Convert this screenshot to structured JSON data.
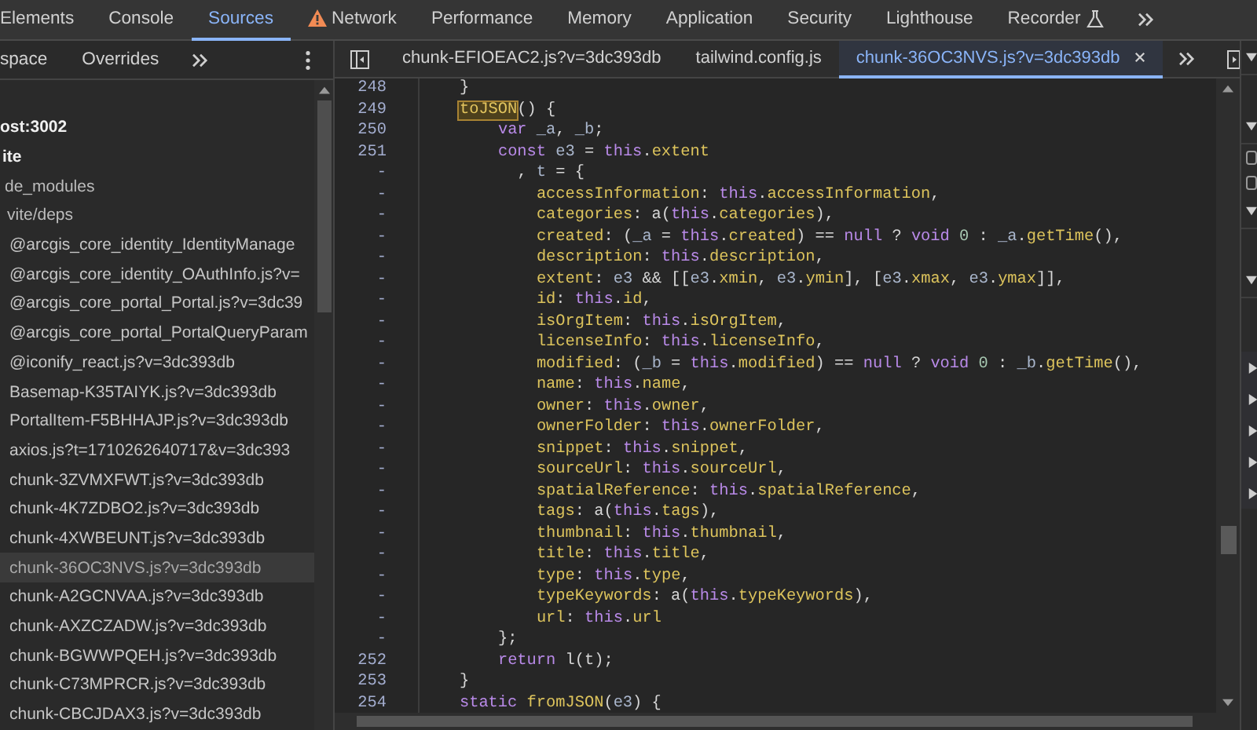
{
  "top_tabs": [
    {
      "label": "Elements",
      "selected": false,
      "kind": "plain"
    },
    {
      "label": "Console",
      "selected": false,
      "kind": "plain"
    },
    {
      "label": "Sources",
      "selected": true,
      "kind": "plain"
    },
    {
      "label": "Network",
      "selected": false,
      "kind": "warning"
    },
    {
      "label": "Performance",
      "selected": false,
      "kind": "plain"
    },
    {
      "label": "Memory",
      "selected": false,
      "kind": "plain"
    },
    {
      "label": "Application",
      "selected": false,
      "kind": "plain"
    },
    {
      "label": "Security",
      "selected": false,
      "kind": "plain"
    },
    {
      "label": "Lighthouse",
      "selected": false,
      "kind": "plain"
    },
    {
      "label": "Recorder",
      "selected": false,
      "kind": "experimental"
    }
  ],
  "navigator_tabs": [
    {
      "label": "space",
      "selected": false
    },
    {
      "label": "Overrides",
      "selected": false
    }
  ],
  "tree": [
    {
      "label": "ost:3002",
      "kind": "origin",
      "selected": false,
      "children": [
        {
          "label": "ite",
          "kind": "origin",
          "selected": false,
          "children": [
            {
              "label": "de_modules",
              "kind": "folder",
              "selected": false,
              "children": [
                {
                  "label": "vite/deps",
                  "kind": "folder",
                  "selected": false,
                  "children": [
                    {
                      "label": "@arcgis_core_identity_IdentityManage",
                      "kind": "file",
                      "selected": false
                    },
                    {
                      "label": "@arcgis_core_identity_OAuthInfo.js?v=",
                      "kind": "file",
                      "selected": false
                    },
                    {
                      "label": "@arcgis_core_portal_Portal.js?v=3dc39",
                      "kind": "file",
                      "selected": false
                    },
                    {
                      "label": "@arcgis_core_portal_PortalQueryParam",
                      "kind": "file",
                      "selected": false
                    },
                    {
                      "label": "@iconify_react.js?v=3dc393db",
                      "kind": "file",
                      "selected": false
                    },
                    {
                      "label": "Basemap-K35TAIYK.js?v=3dc393db",
                      "kind": "file",
                      "selected": false
                    },
                    {
                      "label": "PortalItem-F5BHHAJP.js?v=3dc393db",
                      "kind": "file",
                      "selected": false
                    },
                    {
                      "label": "axios.js?t=1710262640717&v=3dc393",
                      "kind": "file",
                      "selected": false
                    },
                    {
                      "label": "chunk-3ZVMXFWT.js?v=3dc393db",
                      "kind": "file",
                      "selected": false
                    },
                    {
                      "label": "chunk-4K7ZDBO2.js?v=3dc393db",
                      "kind": "file",
                      "selected": false
                    },
                    {
                      "label": "chunk-4XWBEUNT.js?v=3dc393db",
                      "kind": "file",
                      "selected": false
                    },
                    {
                      "label": "chunk-36OC3NVS.js?v=3dc393db",
                      "kind": "file",
                      "selected": true
                    },
                    {
                      "label": "chunk-A2GCNVAA.js?v=3dc393db",
                      "kind": "file",
                      "selected": false
                    },
                    {
                      "label": "chunk-AXZCZADW.js?v=3dc393db",
                      "kind": "file",
                      "selected": false
                    },
                    {
                      "label": "chunk-BGWWPQEH.js?v=3dc393db",
                      "kind": "file",
                      "selected": false
                    },
                    {
                      "label": "chunk-C73MPRCR.js?v=3dc393db",
                      "kind": "file",
                      "selected": false
                    },
                    {
                      "label": "chunk-CBCJDAX3.js?v=3dc393db",
                      "kind": "file",
                      "selected": false
                    }
                  ]
                }
              ]
            }
          ]
        }
      ]
    }
  ],
  "file_tabs": [
    {
      "label": "chunk-EFIOEAC2.js?v=3dc393db",
      "selected": false
    },
    {
      "label": "tailwind.config.js",
      "selected": false
    },
    {
      "label": "chunk-36OC3NVS.js?v=3dc393db",
      "selected": true
    }
  ],
  "code_lines": [
    {
      "number": "248",
      "kind": "member",
      "tokens": [
        {
          "kind": "punc",
          "text": "}"
        }
      ]
    },
    {
      "number": "249",
      "kind": "member",
      "tokens": [
        {
          "kind": "match",
          "text": "toJSON"
        },
        {
          "kind": "punc",
          "text": "() {"
        }
      ]
    },
    {
      "number": "250",
      "kind": "statement",
      "tokens": [
        {
          "kind": "kw",
          "text": "var"
        },
        {
          "kind": "var",
          "text": " _a"
        },
        {
          "kind": "punc",
          "text": ", "
        },
        {
          "kind": "var",
          "text": "_b"
        },
        {
          "kind": "punc",
          "text": ";"
        }
      ]
    },
    {
      "number": "251",
      "kind": "statement",
      "tokens": [
        {
          "kind": "kw",
          "text": "const"
        },
        {
          "kind": "var",
          "text": " e3"
        },
        {
          "kind": "punc",
          "text": " = "
        },
        {
          "kind": "kw",
          "text": "this"
        },
        {
          "kind": "punc",
          "text": "."
        },
        {
          "kind": "prop",
          "text": "extent"
        }
      ]
    },
    {
      "number": "-",
      "kind": "continuation",
      "tokens": [
        {
          "kind": "punc",
          "text": ", "
        },
        {
          "kind": "var",
          "text": "t"
        },
        {
          "kind": "punc",
          "text": " = {"
        }
      ]
    },
    {
      "number": "-",
      "kind": "property",
      "tokens": [
        {
          "kind": "prop",
          "text": "accessInformation"
        },
        {
          "kind": "punc",
          "text": ": "
        },
        {
          "kind": "kw",
          "text": "this"
        },
        {
          "kind": "punc",
          "text": "."
        },
        {
          "kind": "prop",
          "text": "accessInformation"
        },
        {
          "kind": "punc",
          "text": ","
        }
      ]
    },
    {
      "number": "-",
      "kind": "property",
      "tokens": [
        {
          "kind": "prop",
          "text": "categories"
        },
        {
          "kind": "punc",
          "text": ": a("
        },
        {
          "kind": "kw",
          "text": "this"
        },
        {
          "kind": "punc",
          "text": "."
        },
        {
          "kind": "prop",
          "text": "categories"
        },
        {
          "kind": "punc",
          "text": "),"
        }
      ]
    },
    {
      "number": "-",
      "kind": "property",
      "tokens": [
        {
          "kind": "prop",
          "text": "created"
        },
        {
          "kind": "punc",
          "text": ": ("
        },
        {
          "kind": "var",
          "text": "_a"
        },
        {
          "kind": "punc",
          "text": " = "
        },
        {
          "kind": "kw",
          "text": "this"
        },
        {
          "kind": "punc",
          "text": "."
        },
        {
          "kind": "prop",
          "text": "created"
        },
        {
          "kind": "punc",
          "text": ") == "
        },
        {
          "kind": "kw",
          "text": "null"
        },
        {
          "kind": "punc",
          "text": " ? "
        },
        {
          "kind": "kw",
          "text": "void"
        },
        {
          "kind": "num",
          "text": " 0"
        },
        {
          "kind": "punc",
          "text": " : "
        },
        {
          "kind": "var",
          "text": "_a"
        },
        {
          "kind": "punc",
          "text": "."
        },
        {
          "kind": "prop",
          "text": "getTime"
        },
        {
          "kind": "punc",
          "text": "(),"
        }
      ]
    },
    {
      "number": "-",
      "kind": "property",
      "tokens": [
        {
          "kind": "prop",
          "text": "description"
        },
        {
          "kind": "punc",
          "text": ": "
        },
        {
          "kind": "kw",
          "text": "this"
        },
        {
          "kind": "punc",
          "text": "."
        },
        {
          "kind": "prop",
          "text": "description"
        },
        {
          "kind": "punc",
          "text": ","
        }
      ]
    },
    {
      "number": "-",
      "kind": "property",
      "tokens": [
        {
          "kind": "prop",
          "text": "extent"
        },
        {
          "kind": "punc",
          "text": ": "
        },
        {
          "kind": "var",
          "text": "e3"
        },
        {
          "kind": "punc",
          "text": " && [["
        },
        {
          "kind": "var",
          "text": "e3"
        },
        {
          "kind": "punc",
          "text": "."
        },
        {
          "kind": "prop",
          "text": "xmin"
        },
        {
          "kind": "punc",
          "text": ", "
        },
        {
          "kind": "var",
          "text": "e3"
        },
        {
          "kind": "punc",
          "text": "."
        },
        {
          "kind": "prop",
          "text": "ymin"
        },
        {
          "kind": "punc",
          "text": "], ["
        },
        {
          "kind": "var",
          "text": "e3"
        },
        {
          "kind": "punc",
          "text": "."
        },
        {
          "kind": "prop",
          "text": "xmax"
        },
        {
          "kind": "punc",
          "text": ", "
        },
        {
          "kind": "var",
          "text": "e3"
        },
        {
          "kind": "punc",
          "text": "."
        },
        {
          "kind": "prop",
          "text": "ymax"
        },
        {
          "kind": "punc",
          "text": "]],"
        }
      ]
    },
    {
      "number": "-",
      "kind": "property",
      "tokens": [
        {
          "kind": "prop",
          "text": "id"
        },
        {
          "kind": "punc",
          "text": ": "
        },
        {
          "kind": "kw",
          "text": "this"
        },
        {
          "kind": "punc",
          "text": "."
        },
        {
          "kind": "prop",
          "text": "id"
        },
        {
          "kind": "punc",
          "text": ","
        }
      ]
    },
    {
      "number": "-",
      "kind": "property",
      "tokens": [
        {
          "kind": "prop",
          "text": "isOrgItem"
        },
        {
          "kind": "punc",
          "text": ": "
        },
        {
          "kind": "kw",
          "text": "this"
        },
        {
          "kind": "punc",
          "text": "."
        },
        {
          "kind": "prop",
          "text": "isOrgItem"
        },
        {
          "kind": "punc",
          "text": ","
        }
      ]
    },
    {
      "number": "-",
      "kind": "property",
      "tokens": [
        {
          "kind": "prop",
          "text": "licenseInfo"
        },
        {
          "kind": "punc",
          "text": ": "
        },
        {
          "kind": "kw",
          "text": "this"
        },
        {
          "kind": "punc",
          "text": "."
        },
        {
          "kind": "prop",
          "text": "licenseInfo"
        },
        {
          "kind": "punc",
          "text": ","
        }
      ]
    },
    {
      "number": "-",
      "kind": "property",
      "tokens": [
        {
          "kind": "prop",
          "text": "modified"
        },
        {
          "kind": "punc",
          "text": ": ("
        },
        {
          "kind": "var",
          "text": "_b"
        },
        {
          "kind": "punc",
          "text": " = "
        },
        {
          "kind": "kw",
          "text": "this"
        },
        {
          "kind": "punc",
          "text": "."
        },
        {
          "kind": "prop",
          "text": "modified"
        },
        {
          "kind": "punc",
          "text": ") == "
        },
        {
          "kind": "kw",
          "text": "null"
        },
        {
          "kind": "punc",
          "text": " ? "
        },
        {
          "kind": "kw",
          "text": "void"
        },
        {
          "kind": "num",
          "text": " 0"
        },
        {
          "kind": "punc",
          "text": " : "
        },
        {
          "kind": "var",
          "text": "_b"
        },
        {
          "kind": "punc",
          "text": "."
        },
        {
          "kind": "prop",
          "text": "getTime"
        },
        {
          "kind": "punc",
          "text": "(),"
        }
      ]
    },
    {
      "number": "-",
      "kind": "property",
      "tokens": [
        {
          "kind": "prop",
          "text": "name"
        },
        {
          "kind": "punc",
          "text": ": "
        },
        {
          "kind": "kw",
          "text": "this"
        },
        {
          "kind": "punc",
          "text": "."
        },
        {
          "kind": "prop",
          "text": "name"
        },
        {
          "kind": "punc",
          "text": ","
        }
      ]
    },
    {
      "number": "-",
      "kind": "property",
      "tokens": [
        {
          "kind": "prop",
          "text": "owner"
        },
        {
          "kind": "punc",
          "text": ": "
        },
        {
          "kind": "kw",
          "text": "this"
        },
        {
          "kind": "punc",
          "text": "."
        },
        {
          "kind": "prop",
          "text": "owner"
        },
        {
          "kind": "punc",
          "text": ","
        }
      ]
    },
    {
      "number": "-",
      "kind": "property",
      "tokens": [
        {
          "kind": "prop",
          "text": "ownerFolder"
        },
        {
          "kind": "punc",
          "text": ": "
        },
        {
          "kind": "kw",
          "text": "this"
        },
        {
          "kind": "punc",
          "text": "."
        },
        {
          "kind": "prop",
          "text": "ownerFolder"
        },
        {
          "kind": "punc",
          "text": ","
        }
      ]
    },
    {
      "number": "-",
      "kind": "property",
      "tokens": [
        {
          "kind": "prop",
          "text": "snippet"
        },
        {
          "kind": "punc",
          "text": ": "
        },
        {
          "kind": "kw",
          "text": "this"
        },
        {
          "kind": "punc",
          "text": "."
        },
        {
          "kind": "prop",
          "text": "snippet"
        },
        {
          "kind": "punc",
          "text": ","
        }
      ]
    },
    {
      "number": "-",
      "kind": "property",
      "tokens": [
        {
          "kind": "prop",
          "text": "sourceUrl"
        },
        {
          "kind": "punc",
          "text": ": "
        },
        {
          "kind": "kw",
          "text": "this"
        },
        {
          "kind": "punc",
          "text": "."
        },
        {
          "kind": "prop",
          "text": "sourceUrl"
        },
        {
          "kind": "punc",
          "text": ","
        }
      ]
    },
    {
      "number": "-",
      "kind": "property",
      "tokens": [
        {
          "kind": "prop",
          "text": "spatialReference"
        },
        {
          "kind": "punc",
          "text": ": "
        },
        {
          "kind": "kw",
          "text": "this"
        },
        {
          "kind": "punc",
          "text": "."
        },
        {
          "kind": "prop",
          "text": "spatialReference"
        },
        {
          "kind": "punc",
          "text": ","
        }
      ]
    },
    {
      "number": "-",
      "kind": "property",
      "tokens": [
        {
          "kind": "prop",
          "text": "tags"
        },
        {
          "kind": "punc",
          "text": ": a("
        },
        {
          "kind": "kw",
          "text": "this"
        },
        {
          "kind": "punc",
          "text": "."
        },
        {
          "kind": "prop",
          "text": "tags"
        },
        {
          "kind": "punc",
          "text": "),"
        }
      ]
    },
    {
      "number": "-",
      "kind": "property",
      "tokens": [
        {
          "kind": "prop",
          "text": "thumbnail"
        },
        {
          "kind": "punc",
          "text": ": "
        },
        {
          "kind": "kw",
          "text": "this"
        },
        {
          "kind": "punc",
          "text": "."
        },
        {
          "kind": "prop",
          "text": "thumbnail"
        },
        {
          "kind": "punc",
          "text": ","
        }
      ]
    },
    {
      "number": "-",
      "kind": "property",
      "tokens": [
        {
          "kind": "prop",
          "text": "title"
        },
        {
          "kind": "punc",
          "text": ": "
        },
        {
          "kind": "kw",
          "text": "this"
        },
        {
          "kind": "punc",
          "text": "."
        },
        {
          "kind": "prop",
          "text": "title"
        },
        {
          "kind": "punc",
          "text": ","
        }
      ]
    },
    {
      "number": "-",
      "kind": "property",
      "tokens": [
        {
          "kind": "prop",
          "text": "type"
        },
        {
          "kind": "punc",
          "text": ": "
        },
        {
          "kind": "kw",
          "text": "this"
        },
        {
          "kind": "punc",
          "text": "."
        },
        {
          "kind": "prop",
          "text": "type"
        },
        {
          "kind": "punc",
          "text": ","
        }
      ]
    },
    {
      "number": "-",
      "kind": "property",
      "tokens": [
        {
          "kind": "prop",
          "text": "typeKeywords"
        },
        {
          "kind": "punc",
          "text": ": a("
        },
        {
          "kind": "kw",
          "text": "this"
        },
        {
          "kind": "punc",
          "text": "."
        },
        {
          "kind": "prop",
          "text": "typeKeywords"
        },
        {
          "kind": "punc",
          "text": "),"
        }
      ]
    },
    {
      "number": "-",
      "kind": "property",
      "tokens": [
        {
          "kind": "prop",
          "text": "url"
        },
        {
          "kind": "punc",
          "text": ": "
        },
        {
          "kind": "kw",
          "text": "this"
        },
        {
          "kind": "punc",
          "text": "."
        },
        {
          "kind": "prop",
          "text": "url"
        }
      ]
    },
    {
      "number": "-",
      "kind": "statement",
      "tokens": [
        {
          "kind": "punc",
          "text": "};"
        }
      ]
    },
    {
      "number": "252",
      "kind": "statement",
      "tokens": [
        {
          "kind": "kw",
          "text": "return"
        },
        {
          "kind": "punc",
          "text": " l(t);"
        }
      ]
    },
    {
      "number": "253",
      "kind": "member",
      "tokens": [
        {
          "kind": "punc",
          "text": "}"
        }
      ]
    },
    {
      "number": "254",
      "kind": "member",
      "tokens": [
        {
          "kind": "kw",
          "text": "static"
        },
        {
          "kind": "prop",
          "text": " fromJSON"
        },
        {
          "kind": "punc",
          "text": "("
        },
        {
          "kind": "var",
          "text": "e3"
        },
        {
          "kind": "punc",
          "text": ") {"
        }
      ]
    }
  ],
  "right_panel": {
    "sections": [
      {
        "expanded": true
      },
      {
        "expanded": true
      },
      {
        "expanded": true
      },
      {
        "expanded": true
      }
    ],
    "checkboxes": [
      {
        "checked": false
      },
      {
        "checked": false
      }
    ],
    "items": [
      {
        "expanded": false
      },
      {
        "expanded": false
      },
      {
        "expanded": false
      },
      {
        "expanded": false
      },
      {
        "expanded": false
      }
    ]
  }
}
